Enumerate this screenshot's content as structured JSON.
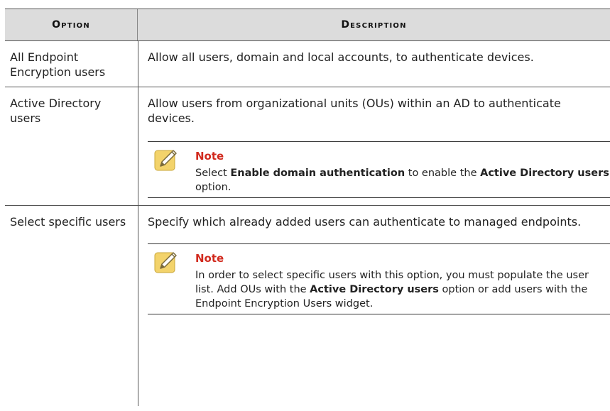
{
  "table": {
    "header": {
      "option": "Option",
      "description": "Description"
    },
    "rows": [
      {
        "option": "All Endpoint Encryption users",
        "description": "Allow all users, domain and local accounts, to authenticate devices."
      },
      {
        "option": "Active Directory users",
        "description": "Allow users from organizational units (OUs) within an AD to authenticate devices.",
        "note": {
          "title": "Note",
          "p1": "Select ",
          "b1": "Enable domain authentication",
          "p2": " to enable the ",
          "b2": "Active Directory users",
          "p3": " option."
        }
      },
      {
        "option": "Select specific users",
        "description": "Specify which already added users can authenticate to managed endpoints.",
        "note": {
          "title": "Note",
          "p1": "In order to select specific users with this option, you must populate the user list. Add OUs with the ",
          "b1": "Active Directory users",
          "p2": " option or add users with the Endpoint Encryption Users widget."
        }
      }
    ]
  }
}
